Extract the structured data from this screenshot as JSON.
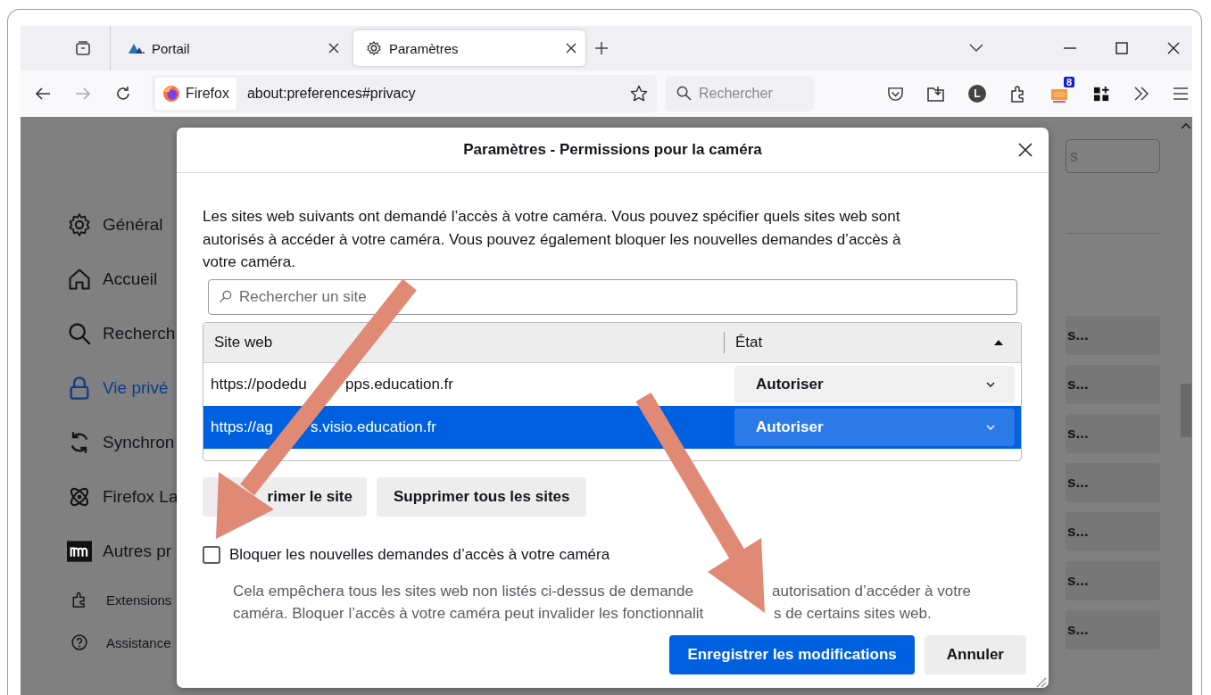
{
  "tabs": [
    {
      "title": "Portail",
      "selected": false,
      "kind": "portal"
    },
    {
      "title": "Paramètres",
      "selected": true,
      "kind": "settings"
    }
  ],
  "nav": {
    "identity": "Firefox",
    "url": "about:preferences#privacy",
    "search_placeholder": "Rechercher",
    "avatar": "L",
    "badge": "8"
  },
  "sidebar": {
    "items": [
      {
        "label": "Général",
        "selected": false,
        "kind": "main"
      },
      {
        "label": "Accueil",
        "selected": false,
        "kind": "main"
      },
      {
        "label": "Recherch",
        "selected": false,
        "kind": "main"
      },
      {
        "label": "Vie privé",
        "selected": true,
        "kind": "main"
      },
      {
        "label": "Synchron",
        "selected": false,
        "kind": "main"
      },
      {
        "label": "Firefox La",
        "selected": false,
        "kind": "main"
      },
      {
        "label": "Autres pr",
        "selected": false,
        "kind": "main"
      },
      {
        "label": "Extensions",
        "selected": false,
        "kind": "footer"
      },
      {
        "label": "Assistance",
        "selected": false,
        "kind": "footer"
      }
    ]
  },
  "background": {
    "field_value": "s",
    "buttons": [
      "s...",
      "s...",
      "s...",
      "s...",
      "s...",
      "s...",
      "s..."
    ]
  },
  "dialog": {
    "title": "Paramètres - Permissions pour la caméra",
    "description": "Les sites web suivants ont demandé l’accès à votre caméra. Vous pouvez spécifier quels sites web sont autorisés à accéder à votre caméra. Vous pouvez également bloquer les nouvelles demandes d’accès à votre caméra.",
    "search_placeholder": "Rechercher un site",
    "columns": [
      "Site web",
      "État"
    ],
    "rows": [
      {
        "site_parts": [
          "https://podedu",
          "pps.education.fr"
        ],
        "state": "Autoriser",
        "selected": false
      },
      {
        "site_parts": [
          "https://ag",
          "s.visio.education.fr"
        ],
        "state": "Autoriser",
        "selected": true
      }
    ],
    "remove_button": "rimer le site",
    "remove_all_button": "Supprimer tous les sites",
    "block": {
      "label": "Bloquer les nouvelles demandes d’accès à votre caméra",
      "checked": false
    },
    "note_lines": [
      [
        "Cela empêchera tous les sites web non listés ci-dessus de demande",
        "autorisation d’accéder à votre"
      ],
      [
        "caméra. Bloquer l’accès à votre caméra peut invalider les fonctionnalit",
        "s de certains sites web."
      ]
    ],
    "save_button": "Enregistrer les modifications",
    "cancel_button": "Annuler"
  }
}
